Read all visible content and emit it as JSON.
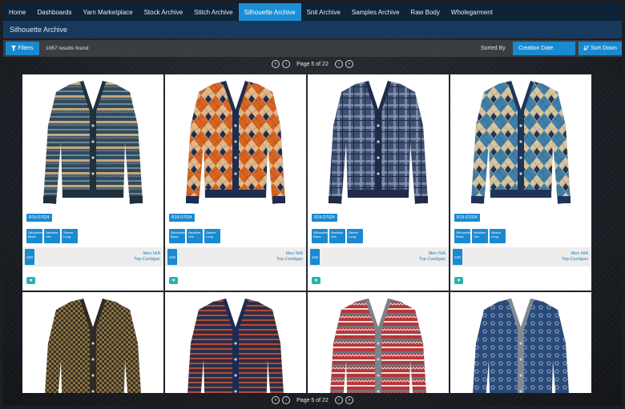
{
  "nav": {
    "items": [
      "Home",
      "Dashboards",
      "Yarn Marketplace",
      "Stock Archive",
      "Stitch Archive",
      "Silhouette Archive",
      "Snit Archive",
      "Samples Archive",
      "Raw Body",
      "Wholegarment"
    ],
    "active_index": 5
  },
  "section": {
    "title": "Silhouette Archive"
  },
  "toolbar": {
    "filters_label": "Filters",
    "filters_icon": "funnel-icon",
    "results_text": "1067 results found",
    "sorted_by_label": "Sorted By",
    "sort_field": "Creation Date",
    "sort_direction": "Sort Down"
  },
  "pager": {
    "text": "Page 5 of 22"
  },
  "colors": {
    "accent": "#1a8ad0",
    "nav_bg": "#0e2238",
    "section_bg": "#17395d",
    "fav": "#2ab2b0"
  },
  "cards": [
    {
      "sku": "R19-D7024",
      "tags": [
        "Silhouette\nBasic",
        "Neckline\nVee",
        "Sleeve\nLong"
      ],
      "gsm": "12G",
      "info_line1": "Men N/A",
      "info_line2": "Top-Cardigan",
      "pattern": "fairisle",
      "palette": [
        "#2f4a5c",
        "#6f8494",
        "#c9a77a",
        "#20303d"
      ]
    },
    {
      "sku": "R19-D7024",
      "tags": [
        "Silhouette\nBasic",
        "Neckline\nVee",
        "Sleeve\nLong"
      ],
      "gsm": "12G",
      "info_line1": "Men N/A",
      "info_line2": "Top-Cardigan",
      "pattern": "argyle",
      "palette": [
        "#e0b88a",
        "#1c2d4f",
        "#d9641f",
        "#1c2d4f"
      ]
    },
    {
      "sku": "R19-D7024",
      "tags": [
        "Silhouette\nBasic",
        "Neckline\nVee",
        "Sleeve\nLong"
      ],
      "gsm": "12G",
      "info_line1": "Men N/A",
      "info_line2": "Top-Cardigan",
      "pattern": "plaid",
      "palette": [
        "#3e4f72",
        "#8e9bb8",
        "#1f2b47",
        "#1f2b47"
      ]
    },
    {
      "sku": "R19-D7024",
      "tags": [
        "Silhouette\nBasic",
        "Neckline\nVee",
        "Sleeve\nLong"
      ],
      "gsm": "12G",
      "info_line1": "Men N/A",
      "info_line2": "Top-Cardigan",
      "pattern": "argyle",
      "palette": [
        "#d9c49c",
        "#1e3557",
        "#3f7fa8",
        "#1e3557"
      ]
    },
    {
      "pattern": "check",
      "palette": [
        "#8b7345",
        "#3a3122",
        "#2f2a24",
        "#2f2a24"
      ]
    },
    {
      "pattern": "stripe",
      "palette": [
        "#2b2e4a",
        "#b24c36",
        "#1c2b55",
        "#1c2b55"
      ]
    },
    {
      "pattern": "fairisle",
      "palette": [
        "#b9343a",
        "#e9e3dc",
        "#6d7479",
        "#7b8288"
      ]
    },
    {
      "pattern": "dots",
      "palette": [
        "#2a4a7a",
        "#9fb4cf",
        "#7f8a93",
        "#7f8a93"
      ]
    }
  ]
}
